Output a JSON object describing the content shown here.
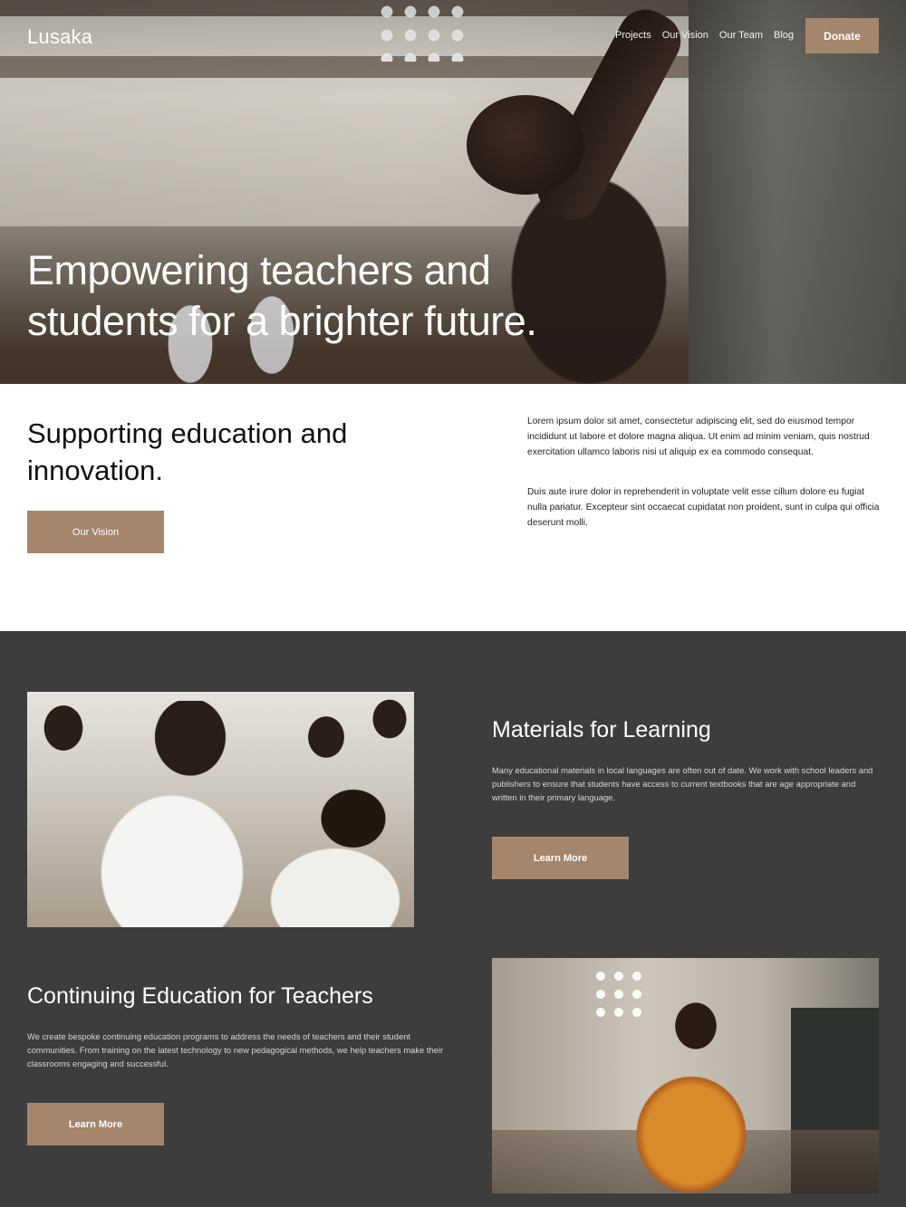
{
  "header": {
    "logo": "Lusaka",
    "nav": [
      "Projects",
      "Our Vision",
      "Our Team",
      "Blog"
    ],
    "donate_label": "Donate"
  },
  "hero": {
    "title_line1": "Empowering teachers and",
    "title_line2": "students for a brighter future."
  },
  "intro": {
    "title": "Supporting education and innovation.",
    "button_label": "Our Vision",
    "paragraph1": "Lorem ipsum dolor sit amet, consectetur adipiscing elit, sed do eiusmod tempor incididunt ut labore et dolore magna aliqua. Ut enim ad minim veniam, quis nostrud exercitation ullamco laboris nisi ut aliquip ex ea commodo consequat.",
    "paragraph2": "Duis aute irure dolor in reprehenderit in voluptate velit esse cillum dolore eu fugiat nulla pariatur. Excepteur sint occaecat cupidatat non proident, sunt in culpa qui officia deserunt molli."
  },
  "materials": {
    "title": "Materials for Learning",
    "text": "Many educational materials in local languages are often out of date. We work with school leaders and publishers to ensure that students have access to current textbooks that are age appropriate and written in their primary language.",
    "button_label": "Learn More"
  },
  "continuing": {
    "title": "Continuing Education for Teachers",
    "text": "We create bespoke continuing education programs to address the needs of teachers and their student communities. From training on the latest technology to new pedagogical methods, we help teachers make their classrooms engaging and successful.",
    "button_label": "Learn More"
  },
  "colors": {
    "accent": "#a5866d",
    "dark_bg": "#3d3d3d"
  }
}
